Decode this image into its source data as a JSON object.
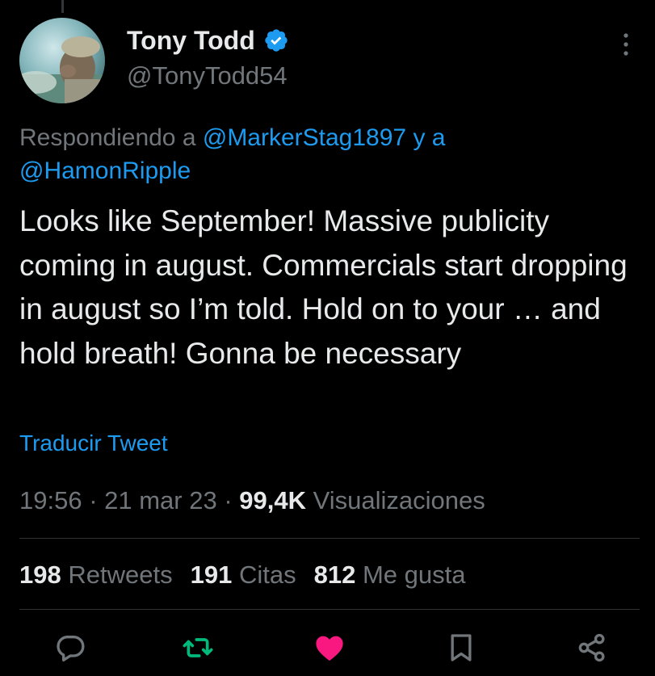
{
  "author": {
    "display_name": "Tony Todd",
    "handle": "@TonyTodd54",
    "verified_icon": "verified-badge-icon",
    "avatar_icon": "avatar-photo"
  },
  "reply": {
    "prefix": "Respondiendo a ",
    "mention_1": "@MarkerStag1897",
    "joiner": " y a",
    "mention_2": "@HamonRipple"
  },
  "tweet": {
    "text": "Looks like September! Massive publicity coming in august. Commercials start dropping in august so I’m told. Hold on to your … and hold breath! Gonna be necessary",
    "translate_link": "Traducir Tweet"
  },
  "meta": {
    "time": "19:56",
    "separator": " · ",
    "date": "21 mar 23",
    "views_count": "99,4K",
    "views_label": "Visualizaciones"
  },
  "stats": {
    "retweets_count": "198",
    "retweets_label": "Retweets",
    "quotes_count": "191",
    "quotes_label": "Citas",
    "likes_count": "812",
    "likes_label": "Me gusta"
  },
  "actions": [
    {
      "icon": "reply-icon"
    },
    {
      "icon": "retweet-icon"
    },
    {
      "icon": "like-icon"
    },
    {
      "icon": "bookmark-icon"
    },
    {
      "icon": "share-icon"
    }
  ],
  "colors": {
    "background": "#000000",
    "text": "#e7e9ea",
    "muted": "#71767b",
    "link": "#1d9bf0",
    "retweet_green": "#00ba7c",
    "like_pink": "#f91880",
    "divider": "#2f3336"
  }
}
